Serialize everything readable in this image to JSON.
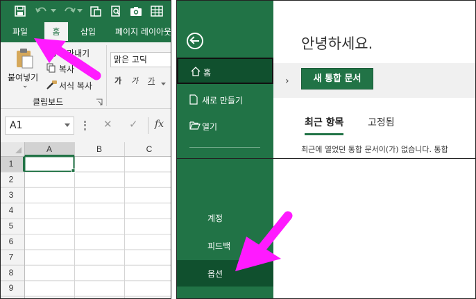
{
  "left_panel": {
    "ribbon_tabs": {
      "file": "파일",
      "home": "홈",
      "insert": "삽입",
      "page_layout": "페이지 레이아웃"
    },
    "clipboard": {
      "paste": "붙여넣기",
      "paste_caret": "⌄",
      "cut": "잘라내기",
      "copy": "복사",
      "format_painter": "서식 복사",
      "group_label": "클립보드"
    },
    "font": {
      "name": "맑은 고딕",
      "bold": "가",
      "italic": "가",
      "underline": "가"
    },
    "formula_bar": {
      "name_box": "A1",
      "cancel": "✕",
      "enter": "✓",
      "function": "fx"
    },
    "sheet": {
      "columns": [
        "A",
        "B",
        "C"
      ],
      "rows": [
        "1",
        "2",
        "3",
        "4",
        "5",
        "6",
        "7",
        "8",
        "9"
      ],
      "active_cell": "A1"
    },
    "colors": {
      "brand": "#217346",
      "highlight": "#ff1aff"
    }
  },
  "right_panel": {
    "back": "back-arrow-icon",
    "nav": {
      "home": "홈",
      "new": "새로 만들기",
      "open": "열기",
      "account": "계정",
      "feedback": "피드백",
      "options": "옵션"
    },
    "greeting": "안녕하세요.",
    "new_workbook": "새 통합 문서",
    "tabs": {
      "recent": "최근 항목",
      "pinned": "고정됨"
    },
    "empty_message": "최근에 열었던 통합 문서이(가) 없습니다. 통합"
  }
}
